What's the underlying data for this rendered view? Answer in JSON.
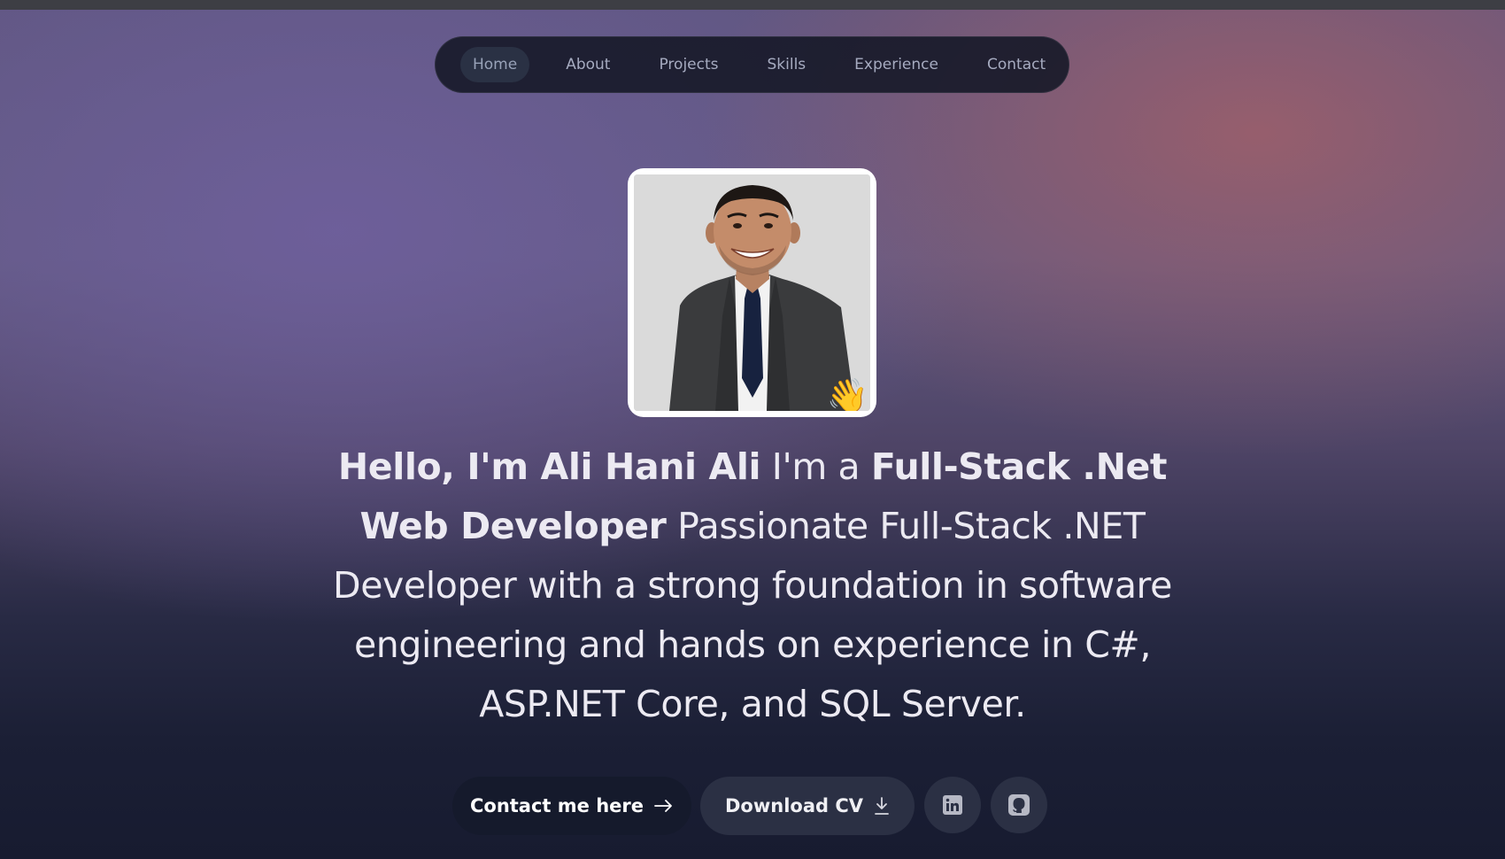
{
  "nav": {
    "items": [
      {
        "label": "Home",
        "active": true
      },
      {
        "label": "About"
      },
      {
        "label": "Projects"
      },
      {
        "label": "Skills"
      },
      {
        "label": "Experience"
      },
      {
        "label": "Contact"
      }
    ]
  },
  "hero": {
    "greeting": "Hello, I'm Ali Hani Ali",
    "role_prefix": " I'm a ",
    "role": "Full-Stack .Net Web Developer",
    "description": " Passionate Full-Stack .NET Developer with a strong foundation in software engineering and hands on experience in C#, ASP.NET Core, and SQL Server.",
    "wave_emoji": "👋"
  },
  "actions": {
    "contact_label": "Contact me here",
    "contact_icon": "arrow-right-icon",
    "cv_label": "Download CV",
    "cv_icon": "download-icon",
    "linkedin_icon": "linkedin-icon",
    "github_icon": "github-icon"
  },
  "colors": {
    "nav_bg": "#161828",
    "active_pill": "#2a3144",
    "primary_button": "#151a2c",
    "secondary_button": "#2b3044",
    "text": "#eceaf2"
  }
}
